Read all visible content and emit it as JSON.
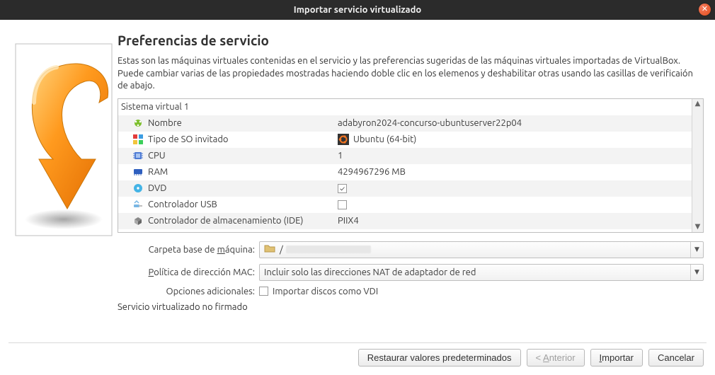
{
  "window": {
    "title": "Importar servicio virtualizado"
  },
  "heading": "Preferencias de servicio",
  "description": "Estas son las máquinas virtuales contenidas en el servicio y las preferencias sugeridas de las máquinas virtuales importadas de VirtualBox. Puede cambiar varias de las propiedades mostradas haciendo doble clic en los elemenos y deshabilitar otras usando las casillas de verificaión de abajo.",
  "system_group": "Sistema virtual 1",
  "rows": {
    "name": {
      "label": "Nombre",
      "value": "adabyron2024-concurso-ubuntuserver22p04"
    },
    "ostype": {
      "label": "Tipo de SO invitado",
      "value": "Ubuntu (64-bit)"
    },
    "cpu": {
      "label": "CPU",
      "value": "1"
    },
    "ram": {
      "label": "RAM",
      "value": "4294967296 MB"
    },
    "dvd": {
      "label": "DVD",
      "checked": true
    },
    "usb": {
      "label": "Controlador USB",
      "checked": false
    },
    "ide": {
      "label": "Controlador de almacenamiento (IDE)",
      "value": "PIIX4"
    }
  },
  "form": {
    "base_folder_label_pre": "Carpeta base de ",
    "base_folder_label_ul": "m",
    "base_folder_label_post": "áquina:",
    "base_folder_value_prefix": "/",
    "mac_label_ul": "P",
    "mac_label_post": "olítica de dirección MAC:",
    "mac_value": "Incluir solo las direcciones NAT de adaptador de red",
    "extra_label": "Opciones adicionales:",
    "import_vdi_label": "Importar discos como VDI",
    "import_vdi_checked": false
  },
  "signature_status": "Servicio virtualizado no firmado",
  "buttons": {
    "restore": "Restaurar valores predeterminados",
    "prev_prefix": "< ",
    "prev_ul": "A",
    "prev_post": "nterior",
    "import_ul": "I",
    "import_post": "mportar",
    "cancel": "Cancelar"
  }
}
